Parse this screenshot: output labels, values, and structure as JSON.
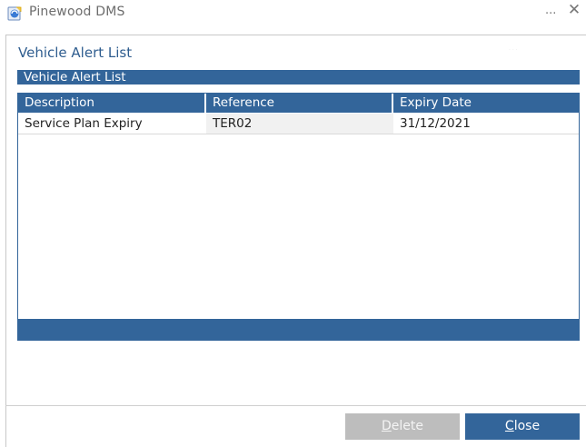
{
  "window": {
    "title": "Pinewood DMS",
    "minimize_glyph": "...",
    "close_glyph": "✕",
    "icon": "pinewood-app-icon"
  },
  "dialog": {
    "title": "Vehicle Alert List",
    "section_header": "Vehicle Alert List"
  },
  "grid": {
    "columns": [
      "Description",
      "Reference",
      "Expiry Date"
    ],
    "rows": [
      {
        "description": "Service Plan Expiry",
        "reference": "TER02",
        "expiry_date": "31/12/2021"
      }
    ]
  },
  "buttons": {
    "delete": {
      "first": "D",
      "rest": "elete",
      "enabled": false
    },
    "close": {
      "first": "C",
      "rest": "lose",
      "enabled": true
    }
  },
  "colors": {
    "accent": "#33659a",
    "title_text": "#2f5d8f",
    "disabled_button": "#bdbdbd"
  }
}
